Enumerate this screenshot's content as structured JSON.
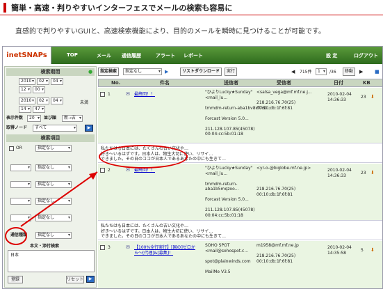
{
  "header": {
    "title": "簡単・高速・判りやすいインターフェスでメールの検索も容易に"
  },
  "description": "直感的で判りやすいGUIと、高速検索機能により、目的のメールを瞬時に見つけることが可能です。",
  "app": {
    "logo": "inetSNAPs",
    "nav": [
      "TOP",
      "メール",
      "通信履歴",
      "アラート",
      "レポート"
    ],
    "nav_right": [
      "設 定",
      "ログアウト"
    ]
  },
  "sidebar": {
    "period_header": "検索期間",
    "date1": {
      "year": "2010",
      "month": "02",
      "day": "04"
    },
    "time1": {
      "h": "12",
      "m": "00"
    },
    "date2": {
      "year": "2010",
      "month": "02",
      "day": "04"
    },
    "time2": {
      "h": "14",
      "m": "47"
    },
    "not_reached": "未満",
    "display_count_label": "表示件数",
    "display_count": "20",
    "order_label": "並び順",
    "order_value": "新→古",
    "mode_label": "取得ノード",
    "mode_value": "すべて",
    "items_header": "検索項目",
    "or_label": "OR",
    "spec_none": "指定なし",
    "comm_label": "通信種類",
    "comm_value": "指定なし",
    "attach_header": "本文・添付検索",
    "keyword": "日本",
    "register_btn": "登録",
    "reset_btn": "リセット"
  },
  "toolbar": {
    "spec_label": "指定検索",
    "spec_value": "指定なし",
    "list_download": "リストダウンロード",
    "exec": "実行",
    "page_total": "715件",
    "page_current": "1",
    "page_of": "/36",
    "move": "移動"
  },
  "table": {
    "headers": [
      "No.",
      "件名",
      "送信者",
      "受信者",
      "日付",
      "KB"
    ],
    "rows": [
      {
        "no": "1",
        "subject": "最終回！！",
        "sender": "\"ひよりLucky★Sunday\"\n<mail_lu...\n\ntmmdm-return-aba1bv8vf76t...\n\nForcast Version 5.0...\n\n211.128.107.85(45078)\n00:04:cc:5b:01:18",
        "receiver": "<salsa_vega@mf.mf.ne.j...\n\n218.216.76.70(25)\n00:10:db:1f:6f:81",
        "date": "2010-02-04\n14:36:33",
        "kb": "23"
      },
      {
        "no": "2",
        "subject": "最終回！！",
        "sender": "\"ひよりLucky★Sunday\"\n<mail_lu...\n\ntmmdm-return-\naba1b5mqzoo...\n\nForcast Version 5.0...\n\n211.128.107.85(45078)\n00:04:cc:5b:01:18",
        "receiver": "<yr-o-@biglobe.mf.ne.jp>\n\n\n\n218.216.76.70(25)\n00:10:db:1f:6f:81",
        "date": "2010-02-04\n14:36:33",
        "kb": "23"
      },
      {
        "no": "3",
        "subject": "【100%全行実行】[国の]ゼロから〜[代理]&[募集]！",
        "sender": "SOHO SPOT\n<mail@sohospot.c...\n\nspot@plainwinds.com\n\nMailMe V3.5",
        "receiver": "m1958@mf.mf.ne.jp\n\n218.216.76.70(25)\n00:10:db:1f:6f:81",
        "date": "2010-02-04\n14:35:58",
        "kb": "5"
      }
    ],
    "body1": "私たちはも日本には、たくさんの古い文化や…\n好き〜いるはずです。日本人は、物生大切に使い、リサイ…\nできました。その日のココが日本人であるあなたの中にも生きて…",
    "body2": "私たちはも日本には、たくさんの古い文化や…\n好き〜いるはずです。日本人は、物生大切に使い、リサイ…\nできました。その日のココが日本人であるあなたの中にも生きて…"
  },
  "colors": {
    "accent": "#cc0000",
    "nav_bg": "#3b7f27",
    "row_bg": "#eaf5e2"
  }
}
